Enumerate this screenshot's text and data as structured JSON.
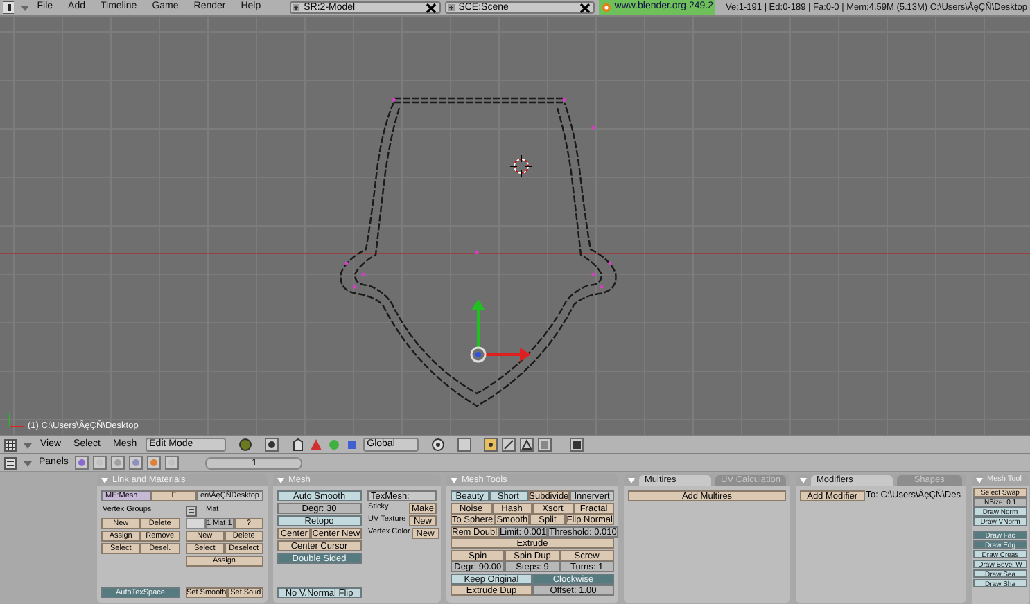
{
  "top_bar": {
    "menus": [
      "File",
      "Add",
      "Timeline",
      "Game",
      "Render",
      "Help"
    ],
    "screen": "SR:2-Model",
    "scene": "SCE:Scene",
    "url": "www.blender.org 249.2",
    "stats": "Ve:1-191 | Ed:0-189 | Fa:0-0 | Mem:4.59M (5.13M) C:\\Users\\ÂęÇŇ\\Desktop"
  },
  "viewport": {
    "info": "(1) C:\\Users\\ÂęÇŇ\\Desktop"
  },
  "view_header": {
    "menus": [
      "View",
      "Select",
      "Mesh"
    ],
    "mode": "Edit Mode",
    "orientation": "Global"
  },
  "buttons_header": {
    "label": "Panels",
    "frame": "1"
  },
  "panels": [
    {
      "title": "Link and Materials",
      "sections": [
        {
          "rows": [
            [
              {
                "kind": "idfield",
                "text": "ME:Mesh"
              },
              {
                "kind": "button",
                "text": "F"
              },
              {
                "kind": "field",
                "text": "eri\\ÂęÇŇDesktop"
              }
            ]
          ]
        },
        {
          "columns": [
            [
              [
                {
                  "kind": "label",
                  "text": "Vertex Groups"
                }
              ],
              [
                {
                  "kind": "button",
                  "text": "New"
                },
                {
                  "kind": "button",
                  "text": "Delete"
                }
              ],
              [
                {
                  "kind": "button",
                  "text": "Assign"
                },
                {
                  "kind": "button",
                  "text": "Remove"
                }
              ],
              [
                {
                  "kind": "button",
                  "text": "Select"
                },
                {
                  "kind": "button",
                  "text": "Desel."
                }
              ],
              [
                {
                  "kind": "toggle",
                  "text": "AutoTexSpace",
                  "on": true
                }
              ]
            ],
            [
              [
                {
                  "kind": "icon"
                },
                {
                  "kind": "label",
                  "text": "Mat"
                }
              ],
              [
                {
                  "kind": "swatch"
                },
                {
                  "kind": "num",
                  "text": "1 Mat 1"
                },
                {
                  "kind": "button",
                  "text": "?"
                }
              ],
              [
                {
                  "kind": "button",
                  "text": "New"
                },
                {
                  "kind": "button",
                  "text": "Delete"
                }
              ],
              [
                {
                  "kind": "button",
                  "text": "Select"
                },
                {
                  "kind": "button",
                  "text": "Deselect"
                }
              ],
              [
                {
                  "kind": "button",
                  "text": "Assign"
                }
              ],
              [
                {
                  "kind": "button",
                  "text": "Set Smooth"
                },
                {
                  "kind": "button",
                  "text": "Set Solid"
                }
              ]
            ]
          ]
        }
      ]
    },
    {
      "title": "Mesh",
      "sections": [
        {
          "columns": [
            [
              [
                {
                  "kind": "toggle",
                  "text": "Auto Smooth",
                  "on": false
                }
              ],
              [
                {
                  "kind": "num",
                  "text": "Degr: 30"
                }
              ],
              [
                {
                  "kind": "toggle",
                  "text": "Retopo",
                  "on": false
                }
              ],
              [
                {
                  "kind": "button",
                  "text": "Center"
                },
                {
                  "kind": "button",
                  "text": "Center New"
                }
              ],
              [
                {
                  "kind": "button",
                  "text": "Center Cursor"
                }
              ],
              [
                {
                  "kind": "toggle",
                  "text": "Double Sided",
                  "on": true
                }
              ],
              [
                {
                  "kind": "toggle",
                  "text": "No V.Normal Flip",
                  "on": false
                }
              ]
            ],
            [
              [
                {
                  "kind": "field",
                  "text": "TexMesh:"
                }
              ],
              [
                {
                  "kind": "label",
                  "text": "Sticky"
                },
                {
                  "kind": "button",
                  "text": "Make"
                }
              ],
              [
                {
                  "kind": "label",
                  "text": "UV Texture"
                },
                {
                  "kind": "button",
                  "text": "New"
                }
              ],
              [
                {
                  "kind": "label",
                  "text": "Vertex Color"
                },
                {
                  "kind": "button",
                  "text": "New"
                }
              ]
            ]
          ]
        }
      ]
    },
    {
      "title": "Mesh Tools",
      "sections": [
        {
          "rows": [
            [
              {
                "kind": "toggle",
                "text": "Beauty",
                "on": false
              },
              {
                "kind": "toggle",
                "text": "Short",
                "on": false
              },
              {
                "kind": "button",
                "text": "Subdivide"
              },
              {
                "kind": "menu",
                "text": "Innervert"
              }
            ],
            [
              {
                "kind": "button",
                "text": "Noise"
              },
              {
                "kind": "button",
                "text": "Hash"
              },
              {
                "kind": "button",
                "text": "Xsort"
              },
              {
                "kind": "button",
                "text": "Fractal"
              }
            ],
            [
              {
                "kind": "button",
                "text": "To Sphere"
              },
              {
                "kind": "button",
                "text": "Smooth"
              },
              {
                "kind": "button",
                "text": "Split"
              },
              {
                "kind": "button",
                "text": "Flip Normal"
              }
            ],
            [
              {
                "kind": "button",
                "text": "Rem Doubl"
              },
              {
                "kind": "num",
                "text": "Limit: 0.001"
              },
              {
                "kind": "num",
                "text": "Threshold: 0.010"
              }
            ],
            [
              {
                "kind": "button",
                "text": "Extrude"
              }
            ],
            [
              {
                "kind": "button",
                "text": "Spin"
              },
              {
                "kind": "button",
                "text": "Spin Dup"
              },
              {
                "kind": "button",
                "text": "Screw"
              }
            ],
            [
              {
                "kind": "num",
                "text": "Degr: 90.00"
              },
              {
                "kind": "num",
                "text": "Steps: 9"
              },
              {
                "kind": "num",
                "text": "Turns: 1"
              }
            ],
            [
              {
                "kind": "toggle",
                "text": "Keep Original",
                "on": false
              },
              {
                "kind": "toggle",
                "text": "Clockwise",
                "on": true
              }
            ],
            [
              {
                "kind": "button",
                "text": "Extrude Dup"
              },
              {
                "kind": "num",
                "text": "Offset: 1.00"
              }
            ]
          ]
        }
      ]
    },
    {
      "tabs": [
        {
          "label": "Multires",
          "selected": true
        },
        {
          "label": "UV Calculation",
          "selected": false
        }
      ],
      "sections": [
        {
          "rows": [
            [
              {
                "kind": "button",
                "text": "Add Multires"
              }
            ]
          ]
        }
      ]
    },
    {
      "tabs": [
        {
          "label": "Modifiers",
          "selected": true
        },
        {
          "label": "Shapes",
          "selected": false
        }
      ],
      "sections": [
        {
          "rows": [
            [
              {
                "kind": "button",
                "text": "Add Modifier"
              },
              {
                "kind": "label",
                "text": "To: C:\\Users\\ÂęÇŇ\\Des"
              }
            ]
          ]
        }
      ]
    },
    {
      "title": "Mesh Tool",
      "sections": [
        {
          "rows": [
            [
              {
                "kind": "button",
                "text": "Select Swap"
              }
            ],
            [
              {
                "kind": "num",
                "text": "NSize: 0.1"
              }
            ],
            [
              {
                "kind": "toggle",
                "text": "Draw Norm",
                "on": false
              }
            ],
            [
              {
                "kind": "toggle",
                "text": "Draw VNorm",
                "on": false
              }
            ]
          ]
        },
        {
          "rows": [
            [
              {
                "kind": "toggle",
                "text": "Draw Fac",
                "on": true
              }
            ],
            [
              {
                "kind": "toggle",
                "text": "Draw Edg",
                "on": true
              }
            ],
            [
              {
                "kind": "toggle",
                "text": "Draw Creas",
                "on": false
              }
            ],
            [
              {
                "kind": "toggle",
                "text": "Draw Bevel W",
                "on": false
              }
            ],
            [
              {
                "kind": "toggle",
                "text": "Draw Sea",
                "on": false
              }
            ],
            [
              {
                "kind": "toggle",
                "text": "Draw Sha",
                "on": false
              }
            ]
          ]
        }
      ]
    }
  ]
}
